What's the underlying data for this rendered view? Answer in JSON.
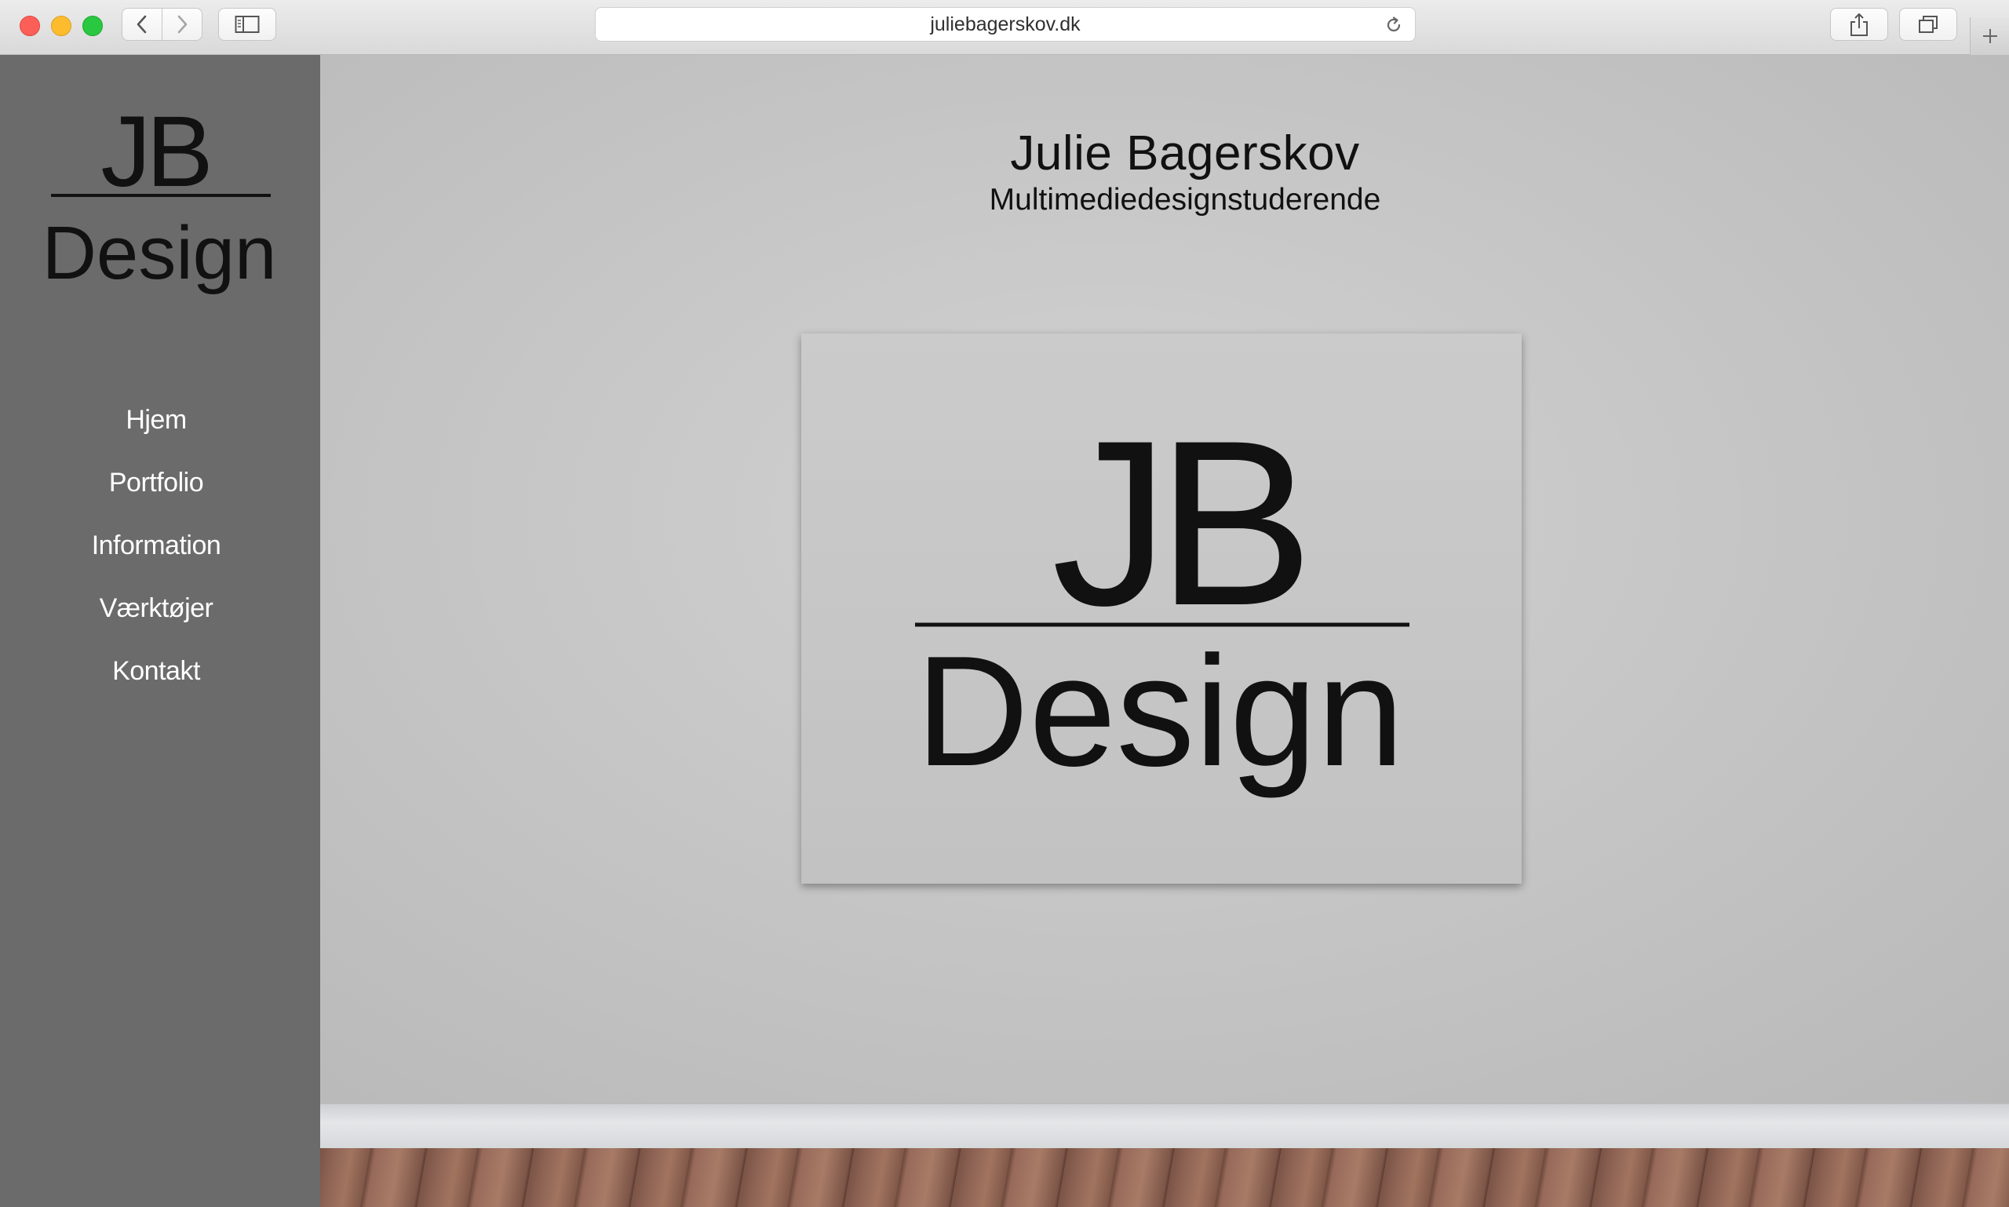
{
  "browser": {
    "url": "juliebagerskov.dk",
    "icons": {
      "back": "chevron-left-icon",
      "forward": "chevron-right-icon",
      "sidebar": "sidebar-icon",
      "reload": "reload-icon",
      "share": "share-icon",
      "tabs": "tabs-overview-icon",
      "new_tab": "plus-icon"
    }
  },
  "sidebar": {
    "logo": {
      "top": "JB",
      "bottom": "Design"
    },
    "nav": [
      {
        "label": "Hjem"
      },
      {
        "label": "Portfolio"
      },
      {
        "label": "Information"
      },
      {
        "label": "Værktøjer"
      },
      {
        "label": "Kontakt"
      }
    ]
  },
  "header": {
    "title": "Julie Bagerskov",
    "subtitle": "Multimediedesignstuderende"
  },
  "canvas": {
    "logo": {
      "top": "JB",
      "bottom": "Design"
    }
  },
  "colors": {
    "sidebar_bg": "#6b6b6b",
    "wall": "#c4c4c4",
    "nav_text": "#ffffff",
    "logo_ink": "#111111"
  }
}
